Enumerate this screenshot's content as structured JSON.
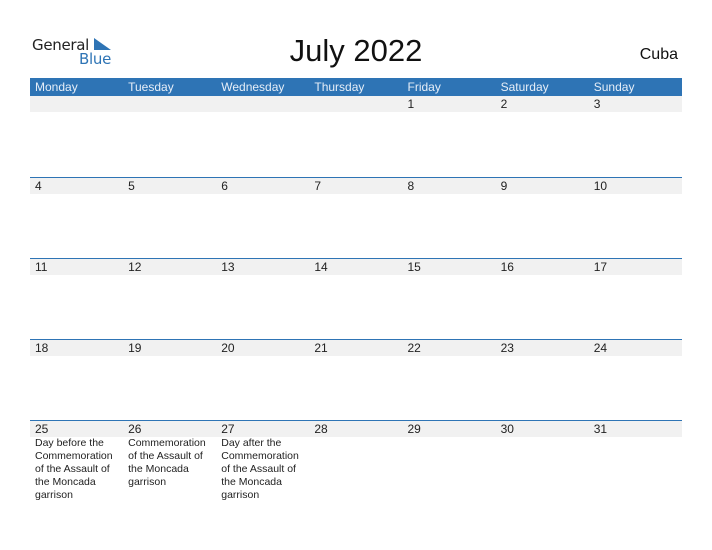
{
  "logo": {
    "word1": "General",
    "word2": "Blue"
  },
  "title": "July 2022",
  "country": "Cuba",
  "colors": {
    "accent": "#2e74b5",
    "band": "#f1f1f1"
  },
  "weekdays": [
    "Monday",
    "Tuesday",
    "Wednesday",
    "Thursday",
    "Friday",
    "Saturday",
    "Sunday"
  ],
  "weeks": [
    {
      "days": [
        "",
        "",
        "",
        "",
        "1",
        "2",
        "3"
      ],
      "notes": [
        "",
        "",
        "",
        "",
        "",
        "",
        ""
      ]
    },
    {
      "days": [
        "4",
        "5",
        "6",
        "7",
        "8",
        "9",
        "10"
      ],
      "notes": [
        "",
        "",
        "",
        "",
        "",
        "",
        ""
      ]
    },
    {
      "days": [
        "11",
        "12",
        "13",
        "14",
        "15",
        "16",
        "17"
      ],
      "notes": [
        "",
        "",
        "",
        "",
        "",
        "",
        ""
      ]
    },
    {
      "days": [
        "18",
        "19",
        "20",
        "21",
        "22",
        "23",
        "24"
      ],
      "notes": [
        "",
        "",
        "",
        "",
        "",
        "",
        ""
      ]
    },
    {
      "days": [
        "25",
        "26",
        "27",
        "28",
        "29",
        "30",
        "31"
      ],
      "notes": [
        "Day before the Commemoration of the Assault of the Moncada garrison",
        "Commemoration of the Assault of the Moncada garrison",
        "Day after the Commemoration of the Assault of the Moncada garrison",
        "",
        "",
        "",
        ""
      ]
    }
  ]
}
